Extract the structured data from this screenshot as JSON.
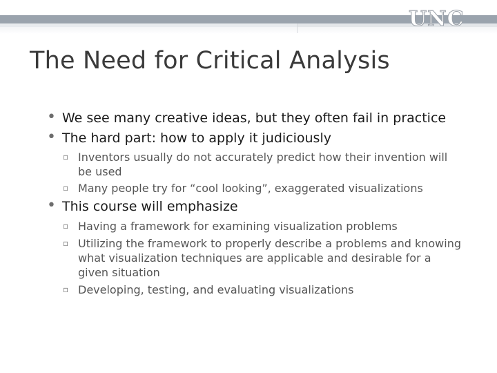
{
  "header": {
    "logo_text": "UNC"
  },
  "title": "The Need for Critical Analysis",
  "bullets": [
    {
      "text": "We see many creative ideas, but they often fail in practice"
    },
    {
      "text": "The hard part: how to apply it judiciously",
      "sub": [
        "Inventors usually do not accurately predict how their invention will be used",
        "Many people try for “cool looking”, exaggerated visualizations"
      ]
    },
    {
      "text": "This course will emphasize",
      "sub": [
        "Having a framework for examining visualization problems",
        "Utilizing the framework to properly describe a problems and knowing what visualization techniques are applicable and desirable for a given situation",
        "Developing, testing, and evaluating visualizations"
      ]
    }
  ],
  "glyphs": {
    "bullet": "•",
    "sub_bullet": "▫"
  }
}
